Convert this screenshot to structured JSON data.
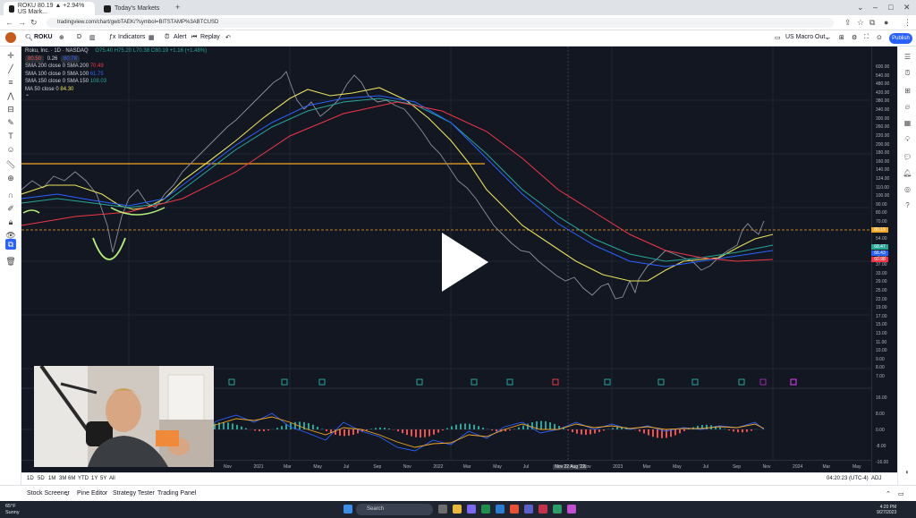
{
  "browser": {
    "tabs": [
      {
        "label": "ROKU 80.19 ▲ +2.94% US Mark..."
      },
      {
        "label": "Today's Markets"
      }
    ],
    "url": "tradingview.com/chart/gwbTAEK/?symbol=BITSTAMP%3ABTCUSD"
  },
  "toolbar": {
    "symbol": "ROKU",
    "interval": "D",
    "indicators_label": "Indicators",
    "alert_label": "Alert",
    "replay_label": "Replay",
    "layout_name": "US Macro Out...",
    "publish_label": "Publish"
  },
  "legend": {
    "title": "Roku, Inc. · 1D · NASDAQ",
    "ohlc": "O75.40  H75.20  L70.38  C80.19  +1.16 (+1.48%)",
    "bid": "80.50",
    "spread": "0.26",
    "ask": "80.78",
    "ma_rows": [
      {
        "label": "SMA 200 close 0 SMA 200",
        "value": "70.49",
        "color": "#f23645"
      },
      {
        "label": "SMA 100 close 0 SMA 100",
        "value": "61.75",
        "color": "#2962ff"
      },
      {
        "label": "SMA 150 close 0 SMA 150",
        "value": "108.03",
        "color": "#26a69a"
      },
      {
        "label": "MA 50 close 0",
        "value": "84.30",
        "color": "#e8e05a"
      }
    ]
  },
  "price_axis": {
    "labels": [
      "600.00",
      "540.00",
      "480.00",
      "420.00",
      "380.00",
      "340.00",
      "300.00",
      "260.00",
      "220.00",
      "200.00",
      "180.00",
      "160.00",
      "140.00",
      "124.00",
      "110.00",
      "100.00",
      "90.00",
      "80.00",
      "70.00",
      "62.00",
      "54.00",
      "48.00",
      "42.00",
      "37.00",
      "33.00",
      "29.00",
      "25.00",
      "22.00",
      "19.00",
      "17.00",
      "15.00",
      "13.00",
      "11.00",
      "10.00",
      "9.00",
      "8.00",
      "7.00"
    ],
    "macd_labels": [
      "16.00",
      "8.00",
      "0.00",
      "-8.00",
      "-16.00"
    ],
    "current_tag": "80.19",
    "ma_tags": [
      "68.47",
      "66.43",
      "60.98"
    ]
  },
  "time_axis": {
    "labels": [
      "Nov",
      "2021",
      "Mar",
      "May",
      "Jul",
      "Sep",
      "Nov",
      "2022",
      "Mar",
      "May",
      "Jul",
      "Nov 22 Aug '22",
      "Nov",
      "2023",
      "Mar",
      "May",
      "Jul",
      "Sep",
      "Nov",
      "2024",
      "Mar",
      "May"
    ],
    "timestamp": "04:20:23 (UTC-4)",
    "adj": "ADJ"
  },
  "ranges": [
    "1D",
    "5D",
    "1M",
    "3M",
    "6M",
    "YTD",
    "1Y",
    "5Y",
    "All"
  ],
  "panels": [
    "Stock Screener",
    "Pine Editor",
    "Strategy Tester",
    "Trading Panel"
  ],
  "taskbar": {
    "weather_temp": "65°F",
    "weather_desc": "Sunny",
    "search_placeholder": "Search",
    "time": "4:20 PM",
    "date": "9/27/2023"
  },
  "chart_data": {
    "type": "line",
    "title": "Roku, Inc. · 1D · NASDAQ",
    "x": [
      "2020-09",
      "2020-11",
      "2021-01",
      "2021-03",
      "2021-05",
      "2021-07",
      "2021-09",
      "2021-11",
      "2022-01",
      "2022-03",
      "2022-05",
      "2022-07",
      "2022-09",
      "2022-11",
      "2023-01",
      "2023-03",
      "2023-05",
      "2023-07",
      "2023-09"
    ],
    "series": [
      {
        "name": "ROKU",
        "values": [
          150,
          175,
          330,
          420,
          330,
          460,
          320,
          240,
          140,
          120,
          70,
          65,
          60,
          45,
          60,
          62,
          60,
          78,
          80
        ]
      },
      {
        "name": "MA 50",
        "values": [
          145,
          150,
          280,
          400,
          380,
          410,
          380,
          290,
          200,
          130,
          100,
          70,
          64,
          56,
          55,
          60,
          62,
          67,
          72
        ]
      }
    ],
    "horizontal_lines": [
      {
        "value": 180,
        "color": "#f5a623"
      },
      {
        "value": 88,
        "color": "#f5a623"
      }
    ]
  },
  "colors": {
    "chart_bg": "#131722",
    "up": "#26a69a",
    "down": "#ef5350",
    "accent": "#2962ff"
  }
}
